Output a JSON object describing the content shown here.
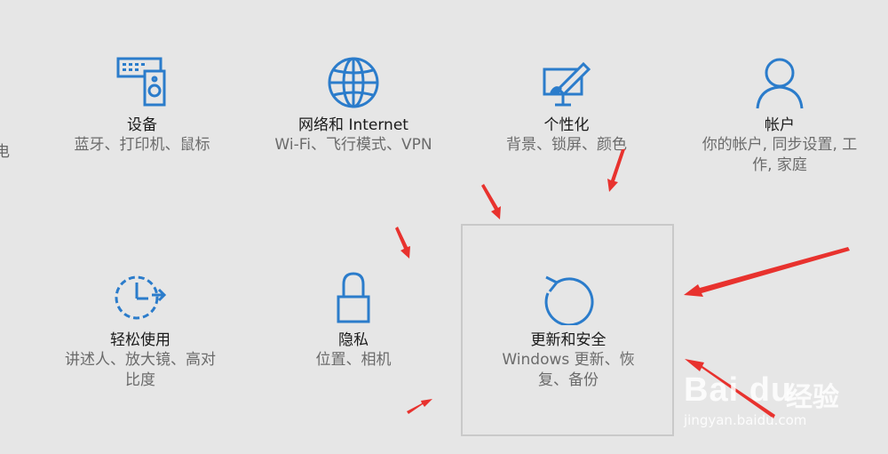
{
  "edge_text": "电",
  "tiles": [
    {
      "title": "设备",
      "desc": "蓝牙、打印机、鼠标",
      "icon": "keyboard-speaker-icon"
    },
    {
      "title": "网络和 Internet",
      "desc": "Wi-Fi、飞行模式、VPN",
      "icon": "globe-icon"
    },
    {
      "title": "个性化",
      "desc": "背景、锁屏、颜色",
      "icon": "monitor-brush-icon"
    },
    {
      "title": "帐户",
      "desc_line1": "你的帐户, 同步设置, 工",
      "desc_line2": "作, 家庭",
      "icon": "person-icon"
    },
    {
      "title": "轻松使用",
      "desc_line1": "讲述人、放大镜、高对",
      "desc_line2": "比度",
      "icon": "ease-of-access-clock-icon"
    },
    {
      "title": "隐私",
      "desc": "位置、相机",
      "icon": "lock-icon"
    },
    {
      "title": "更新和安全",
      "desc_line1": "Windows 更新、恢",
      "desc_line2": "复、备份",
      "icon": "refresh-icon"
    }
  ],
  "watermark": {
    "logo": "Bai du",
    "cn": "经验",
    "url": "jingyan.baidu.com"
  },
  "colors": {
    "accent": "#2b7ccb",
    "arrow": "#e8322e",
    "background": "#e6e6e6"
  }
}
